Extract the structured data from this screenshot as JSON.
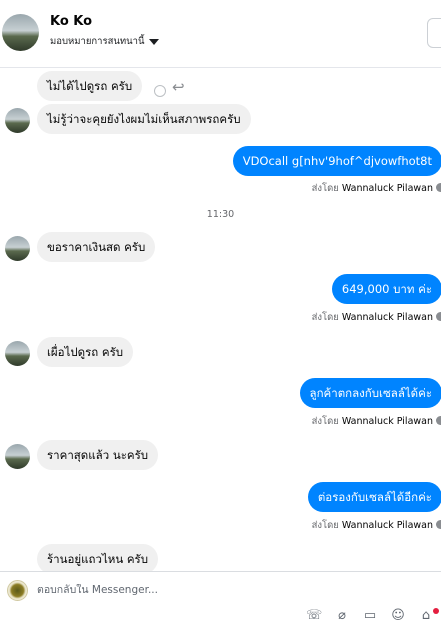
{
  "header": {
    "contact_name": "Ko Ko",
    "assign_label": "มอบหมายการสนทนานี้"
  },
  "messages": [
    {
      "dir": "in",
      "text": "ไม่ได้ไปดูรถ ครับ"
    },
    {
      "dir": "in",
      "text": "ไม่รู้ว่าจะคุยยังไงผมไม่เห็นสภาพรถครับ"
    },
    {
      "dir": "out",
      "text": "VDOcall g[nhv'9hof^djvowfhot8t"
    },
    {
      "dir": "in",
      "text": "ขอราคาเงินสด  ครับ"
    },
    {
      "dir": "out",
      "text": "649,000 บาท   ค่ะ"
    },
    {
      "dir": "in",
      "text": "เผื่อไปดูรถ ครับ"
    },
    {
      "dir": "out",
      "text": "ลูกค้าตกลงกับเซลล์ได้ค่ะ"
    },
    {
      "dir": "in",
      "text": "ราคาสุดแล้ว นะครับ"
    },
    {
      "dir": "out",
      "text": "ต่อรองกับเซลล์ได้อีกค่ะ"
    },
    {
      "dir": "in",
      "text": "ร้านอยู่แถวไหน ครับ"
    }
  ],
  "sent_by": {
    "prefix": "ส่งโดย",
    "name": "Wannaluck Pilawan"
  },
  "time_divider": "11:30",
  "composer": {
    "placeholder": "ตอบกลับใน Messenger...",
    "tools": [
      "phone-add-icon",
      "attachment-icon",
      "quick-reply-icon",
      "emoji-icon",
      "store-icon"
    ]
  },
  "colors": {
    "outgoing_bubble": "#0084ff",
    "incoming_bubble": "#f0f0f0"
  }
}
